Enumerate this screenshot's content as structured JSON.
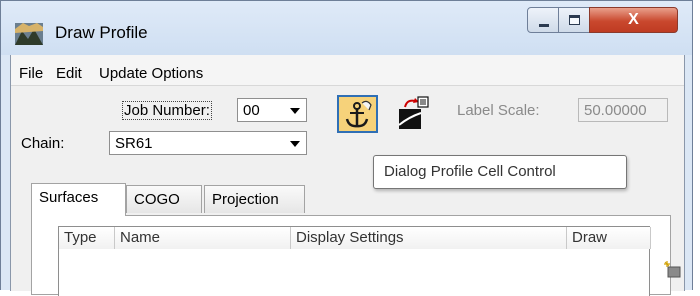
{
  "window": {
    "title": "Draw Profile",
    "icons": [
      "app-icon",
      "minimize-icon",
      "maximize-icon",
      "close-icon"
    ],
    "close_glyph": "X"
  },
  "menu": {
    "items": [
      "File",
      "Edit",
      "Update Options"
    ]
  },
  "form": {
    "job_number_label": "Job Number:",
    "job_number_value": "00",
    "chain_label": "Chain:",
    "chain_value": "SR61",
    "label_scale_label": "Label Scale:",
    "label_scale_value": "50.00000"
  },
  "toolbar": {
    "cell_control_icon": "anchor-hand-icon",
    "profile_icon": "profile-draw-icon",
    "tooltip": "Dialog Profile Cell Control"
  },
  "tabs": [
    {
      "label": "Surfaces",
      "active": true
    },
    {
      "label": "COGO",
      "active": false
    },
    {
      "label": "Projection",
      "active": false
    }
  ],
  "table": {
    "columns": [
      "Type",
      "Name",
      "Display Settings",
      "Draw"
    ]
  },
  "colors": {
    "accent_button": "#f6d27a",
    "close_button": "#c9482e",
    "titlebar": "#dbe7f5"
  }
}
